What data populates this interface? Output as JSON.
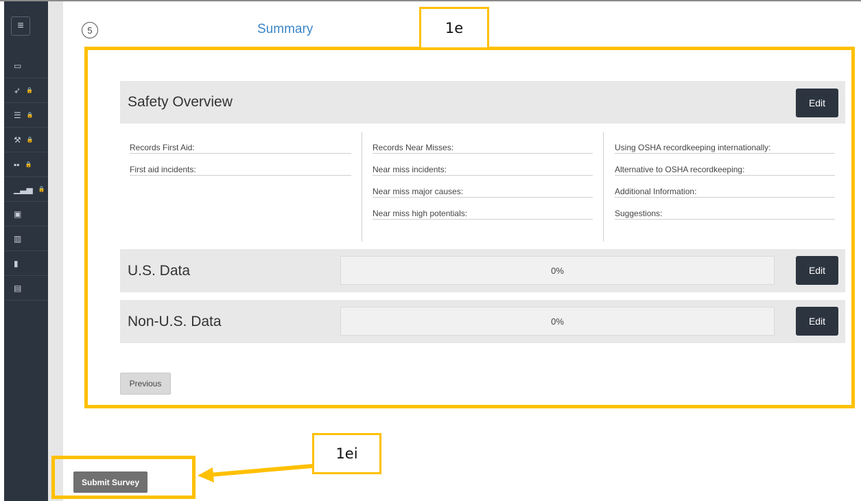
{
  "sidebar": {
    "menu_icon": "hamburger-icon",
    "items": [
      {
        "icon": "window-icon",
        "locked": false
      },
      {
        "icon": "paper-plane-icon",
        "locked": true
      },
      {
        "icon": "list-icon",
        "locked": true
      },
      {
        "icon": "tools-icon",
        "locked": true
      },
      {
        "icon": "grid-icon",
        "locked": true
      },
      {
        "icon": "bar-chart-icon",
        "locked": true
      },
      {
        "icon": "id-card-icon",
        "locked": false
      },
      {
        "icon": "open-book-icon",
        "locked": false
      },
      {
        "icon": "book-icon",
        "locked": false
      },
      {
        "icon": "document-icon",
        "locked": false
      }
    ]
  },
  "header": {
    "step_number": "5",
    "title": "Summary"
  },
  "annotations": {
    "frame_label": "1e",
    "submit_label": "1ei",
    "color": "#ffc000"
  },
  "safety": {
    "title": "Safety Overview",
    "edit_label": "Edit",
    "columns": [
      [
        "Records First Aid:",
        "First aid incidents:"
      ],
      [
        "Records Near Misses:",
        "Near miss incidents:",
        "Near miss major causes:",
        "Near miss high potentials:"
      ],
      [
        "Using OSHA recordkeeping internationally:",
        "Alternative to OSHA recordkeeping:",
        "Additional Information:",
        "Suggestions:"
      ]
    ]
  },
  "us_data": {
    "title": "U.S. Data",
    "progress": "0%",
    "edit_label": "Edit"
  },
  "non_us_data": {
    "title": "Non-U.S. Data",
    "progress": "0%",
    "edit_label": "Edit"
  },
  "buttons": {
    "previous": "Previous",
    "submit": "Submit Survey"
  },
  "colors": {
    "sidebar": "#2c3440",
    "accent": "#3a86c8",
    "annotation": "#ffc000"
  }
}
